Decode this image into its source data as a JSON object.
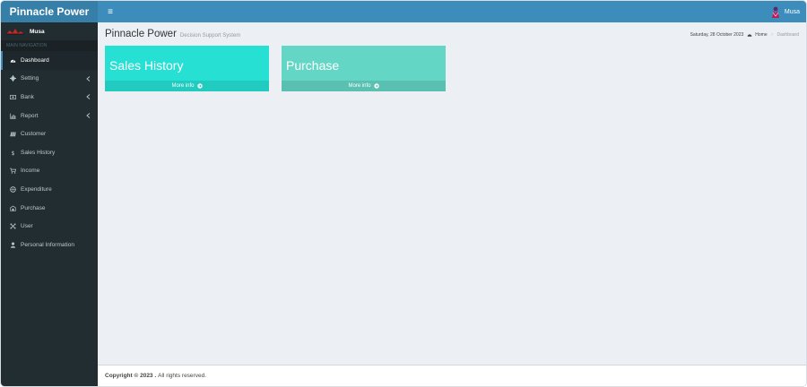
{
  "brand": {
    "title": "Pinnacle Power"
  },
  "topbar": {
    "toggle_glyph": "≡",
    "user_name": "Musa"
  },
  "sidebar": {
    "user_name": "Musa",
    "nav_header": "MAIN NAVIGATION",
    "items": [
      {
        "label": "Dashboard",
        "icon": "dashboard-icon"
      },
      {
        "label": "Setting",
        "icon": "gear-icon"
      },
      {
        "label": "Bank",
        "icon": "money-icon"
      },
      {
        "label": "Report",
        "icon": "bar-chart-icon"
      },
      {
        "label": "Customer",
        "icon": "customer-icon"
      },
      {
        "label": "Sales History",
        "icon": "dollar-icon"
      },
      {
        "label": "Income",
        "icon": "cart-icon"
      },
      {
        "label": "Expenditure",
        "icon": "globe-icon"
      },
      {
        "label": "Purchase",
        "icon": "purchase-icon"
      },
      {
        "label": "User",
        "icon": "arrows-icon"
      },
      {
        "label": "Personal Information",
        "icon": "user-icon"
      }
    ]
  },
  "page": {
    "title": "Pinnacle Power",
    "subtitle": "Decision Support System",
    "date": "Saturday, 28 October 2023",
    "breadcrumb": {
      "home": "Home",
      "current": "Dashboard"
    }
  },
  "boxes": {
    "sales": {
      "title": "Sales History",
      "more": "More info"
    },
    "purchase": {
      "title": "Purchase",
      "more": "More info"
    }
  },
  "footer": {
    "copyright": "Copyright © 2023 .",
    "rights": "All rights reserved."
  },
  "colors": {
    "header": "#3c8dbc",
    "logo": "#367fa9",
    "sidebar": "#222d32",
    "sales_box": "#26e0d3",
    "purchase_box": "#64d6c6"
  }
}
